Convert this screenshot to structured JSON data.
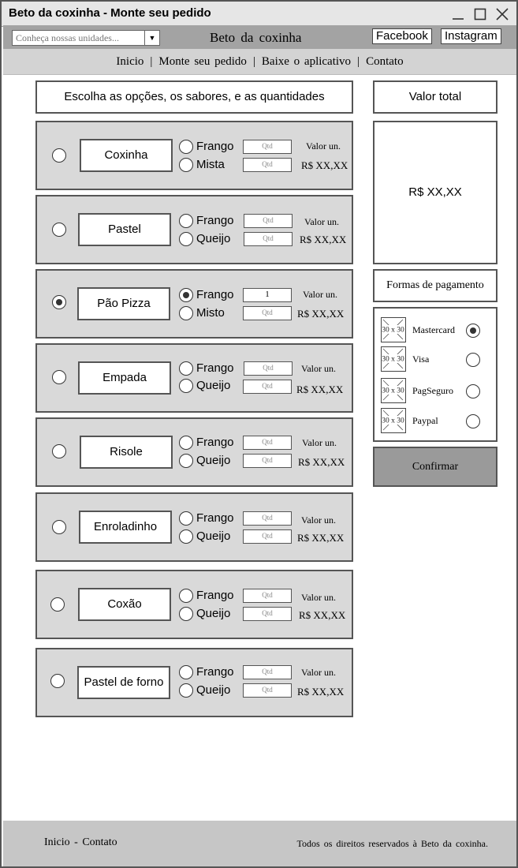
{
  "window": {
    "title": "Beto da coxinha - Monte seu pedido"
  },
  "header": {
    "search_placeholder": "Conheça nossas unidades...",
    "brand": "Beto da coxinha",
    "facebook": "Facebook",
    "instagram": "Instagram"
  },
  "nav": {
    "items": [
      "Inicio",
      "Monte seu pedido",
      "Baixe o aplicativo",
      "Contato"
    ],
    "separator": "|"
  },
  "instructions": "Escolha as opções, os sabores, e as quantidades",
  "products": [
    {
      "name": "Coxinha",
      "selected": false,
      "options": [
        {
          "label": "Frango",
          "selected": false,
          "qty": "Qtd"
        },
        {
          "label": "Mista",
          "selected": false,
          "qty": "Qtd"
        }
      ],
      "unit_label": "Valor un.",
      "price": "R$ XX,XX"
    },
    {
      "name": "Pastel",
      "selected": false,
      "options": [
        {
          "label": "Frango",
          "selected": false,
          "qty": "Qtd"
        },
        {
          "label": "Queijo",
          "selected": false,
          "qty": "Qtd"
        }
      ],
      "unit_label": "Valor un.",
      "price": "R$ XX,XX"
    },
    {
      "name": "Pão Pizza",
      "selected": true,
      "options": [
        {
          "label": "Frango",
          "selected": true,
          "qty": "1"
        },
        {
          "label": "Misto",
          "selected": false,
          "qty": "Qtd"
        }
      ],
      "unit_label": "Valor un.",
      "price": "R$ XX,XX"
    },
    {
      "name": "Empada",
      "selected": false,
      "options": [
        {
          "label": "Frango",
          "selected": false,
          "qty": "Qtd"
        },
        {
          "label": "Queijo",
          "selected": false,
          "qty": "Qtd"
        }
      ],
      "unit_label": "Valor un.",
      "price": "R$ XX,XX"
    },
    {
      "name": "Risole",
      "selected": false,
      "options": [
        {
          "label": "Frango",
          "selected": false,
          "qty": "Qtd"
        },
        {
          "label": "Queijo",
          "selected": false,
          "qty": "Qtd"
        }
      ],
      "unit_label": "Valor un.",
      "price": "R$ XX,XX"
    },
    {
      "name": "Enroladinho",
      "selected": false,
      "options": [
        {
          "label": "Frango",
          "selected": false,
          "qty": "Qtd"
        },
        {
          "label": "Queijo",
          "selected": false,
          "qty": "Qtd"
        }
      ],
      "unit_label": "Valor un.",
      "price": "R$ XX,XX"
    },
    {
      "name": "Coxão",
      "selected": false,
      "options": [
        {
          "label": "Frango",
          "selected": false,
          "qty": "Qtd"
        },
        {
          "label": "Queijo",
          "selected": false,
          "qty": "Qtd"
        }
      ],
      "unit_label": "Valor un.",
      "price": "R$ XX,XX"
    },
    {
      "name": "Pastel de forno",
      "selected": false,
      "options": [
        {
          "label": "Frango",
          "selected": false,
          "qty": "Qtd"
        },
        {
          "label": "Queijo",
          "selected": false,
          "qty": "Qtd"
        }
      ],
      "unit_label": "Valor un.",
      "price": "R$ XX,XX"
    }
  ],
  "summary": {
    "total_label": "Valor total",
    "total_value": "R$ XX,XX",
    "payment_label": "Formas de pagamento",
    "payment_methods": [
      {
        "name": "Mastercard",
        "selected": true,
        "icon": "image-placeholder-icon",
        "icon_text": "30 x 30"
      },
      {
        "name": "Visa",
        "selected": false,
        "icon": "image-placeholder-icon",
        "icon_text": "30 x 30"
      },
      {
        "name": "PagSeguro",
        "selected": false,
        "icon": "image-placeholder-icon",
        "icon_text": "30 x 30"
      },
      {
        "name": "Paypal",
        "selected": false,
        "icon": "image-placeholder-icon",
        "icon_text": "30 x 30"
      }
    ],
    "confirm_label": "Confirmar"
  },
  "footer": {
    "links": [
      "Inicio",
      "Contato"
    ],
    "separator": "-",
    "copyright": "Todos os direitos reservados à Beto da coxinha."
  }
}
